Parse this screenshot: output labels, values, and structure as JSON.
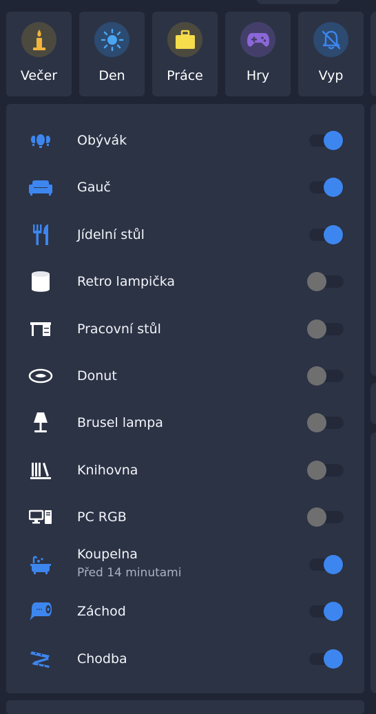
{
  "scenes": [
    {
      "label": "Večer",
      "icon": "candle-icon",
      "circle_color": "#4c4a3f",
      "icon_color": "#f2b53c"
    },
    {
      "label": "Den",
      "icon": "sun-icon",
      "circle_color": "#2d4a70",
      "icon_color": "#4aa6f2"
    },
    {
      "label": "Práce",
      "icon": "briefcase-icon",
      "circle_color": "#4c4a3f",
      "icon_color": "#f5dd4c"
    },
    {
      "label": "Hry",
      "icon": "gamepad-icon",
      "circle_color": "#443f6a",
      "icon_color": "#8b67d8"
    },
    {
      "label": "Vyp",
      "icon": "bell-off-icon",
      "circle_color": "#2d4a70",
      "icon_color": "#3d86ef"
    }
  ],
  "lights": [
    {
      "name": "Obývák",
      "icon": "ceiling-lights-icon",
      "state": "on",
      "subtitle": ""
    },
    {
      "name": "Gauč",
      "icon": "sofa-icon",
      "state": "on",
      "subtitle": ""
    },
    {
      "name": "Jídelní stůl",
      "icon": "silverware-icon",
      "state": "on",
      "subtitle": ""
    },
    {
      "name": "Retro lampička",
      "icon": "cylinder-lamp-icon",
      "state": "off",
      "subtitle": ""
    },
    {
      "name": "Pracovní stůl",
      "icon": "desk-icon",
      "state": "off",
      "subtitle": ""
    },
    {
      "name": "Donut",
      "icon": "donut-lamp-icon",
      "state": "off",
      "subtitle": ""
    },
    {
      "name": "Brusel lampa",
      "icon": "table-lamp-icon",
      "state": "off",
      "subtitle": ""
    },
    {
      "name": "Knihovna",
      "icon": "bookshelf-icon",
      "state": "off",
      "subtitle": ""
    },
    {
      "name": "PC RGB",
      "icon": "desktop-tower-icon",
      "state": "off",
      "subtitle": ""
    },
    {
      "name": "Koupelna",
      "icon": "bathtub-icon",
      "state": "on",
      "subtitle": "Před 14 minutami"
    },
    {
      "name": "Záchod",
      "icon": "toilet-paper-icon",
      "state": "on",
      "subtitle": ""
    },
    {
      "name": "Chodba",
      "icon": "led-strip-icon",
      "state": "on",
      "subtitle": ""
    }
  ],
  "colors": {
    "accent": "#3d86ef",
    "toggle_off_knob": "#6f6f6f",
    "card": "#2c3345",
    "background": "#1f2535",
    "on_icon": "#3d86ef",
    "off_icon": "#ffffff"
  }
}
